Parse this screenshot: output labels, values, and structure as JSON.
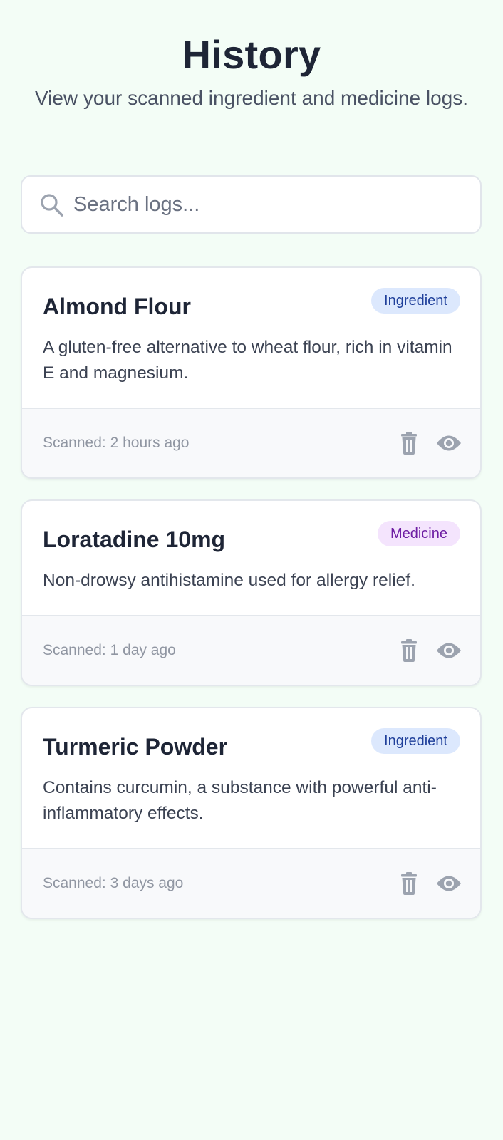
{
  "header": {
    "title": "History",
    "subtitle": "View your scanned ingredient and medicine logs."
  },
  "search": {
    "placeholder": "Search logs...",
    "value": "",
    "icon": "search-icon"
  },
  "logs": [
    {
      "title": "Almond Flour",
      "badge": "Ingredient",
      "badge_type": "ingredient",
      "description": "A gluten-free alternative to wheat flour, rich in vitamin E and magnesium.",
      "scanned": "Scanned: 2 hours ago"
    },
    {
      "title": "Loratadine 10mg",
      "badge": "Medicine",
      "badge_type": "medicine",
      "description": "Non-drowsy antihistamine used for allergy relief.",
      "scanned": "Scanned: 1 day ago"
    },
    {
      "title": "Turmeric Powder",
      "badge": "Ingredient",
      "badge_type": "ingredient",
      "description": "Contains curcumin, a substance with powerful anti-inflammatory effects.",
      "scanned": "Scanned: 3 days ago"
    }
  ],
  "colors": {
    "background": "#f3fdf6",
    "ingredient_badge_bg": "#dce8fd",
    "ingredient_badge_text": "#1f3f9a",
    "medicine_badge_bg": "#f4e4fd",
    "medicine_badge_text": "#6e1ea3",
    "icon_gray": "#9ca3af"
  }
}
